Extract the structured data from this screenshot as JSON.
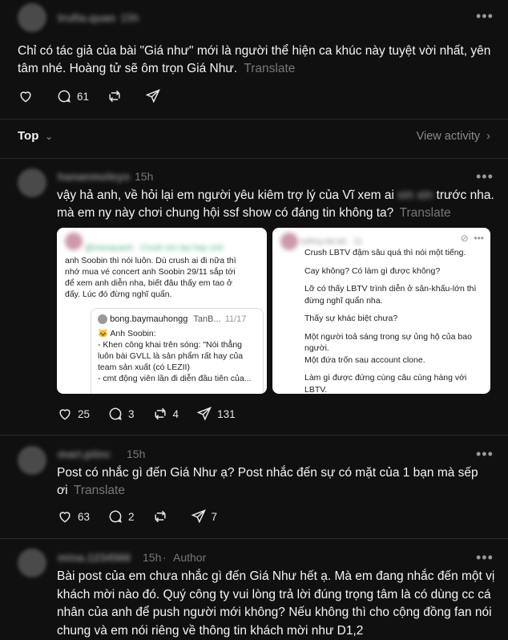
{
  "top_post": {
    "username": "trufia.quan",
    "time": "15h",
    "line1": "Chỉ có tác giả của bài \"Giá như\" mới là người thể hiện ca khúc này tuyệt vời nhất, yên",
    "line2": "tâm nhé. Hoàng tử sẽ ôm trọn Giá Như.",
    "translate": "Translate",
    "replies": "61"
  },
  "sort_bar": {
    "label": "Top",
    "view_activity": "View activity"
  },
  "reply1": {
    "username": "hananmoleyo",
    "time": "15h",
    "line1": "vậy hả anh, về hỏi lại em người yêu kiêm trợ lý của Vĩ xem ai",
    "blurred": "xin xin",
    "line1_end": "trước nha.",
    "line2": "mà em ny này chơi chung hội ssf show có đáng tin không ta?",
    "translate": "Translate",
    "likes": "25",
    "replies": "3",
    "reposts": "4",
    "shares": "131",
    "img1": {
      "l1": "anh Soobin thì nói luôn. Dù crush ai đi nữa thì",
      "l2": "nhớ mua vé concert anh Soobin 29/11 sắp tới",
      "l3": "để xem anh diễn nha, biết đâu thấy em tao ở",
      "l4": "đấy. Lúc đó đừng nghĩ quẩn.",
      "q_user": "bong.baymauhongg",
      "q_more": "TanB...",
      "q_date": "11/17",
      "q1": "Anh Soobin:",
      "q2": "- Khen công khai trên sóng: \"Nói thẳng",
      "q3": "luôn bài GVLL là sản phẩm rất hay của",
      "q4": "team sản xuất (có LEZII)",
      "q5": "- cmt động viên lần đi diễn đầu tiên của..."
    },
    "img2": {
      "l1": "Crush LBTV đậm sâu quá thì nói một tiếng.",
      "l2": "Cay không? Có làm gì được không?",
      "l3": "Lỡ có thấy LBTV trình diễn ở sân-khấu-lớn thì",
      "l4": "đừng nghĩ quẩn nha.",
      "l5": "Thấy sự khác biệt chưa?",
      "l6": "Một người toả sáng trong sự ủng hộ của bao",
      "l7": "người.",
      "l8": "Một đứa trốn sau account clone.",
      "l9": "Làm gì được đứng cùng câu cùng hàng với",
      "l10": "LBTV."
    }
  },
  "reply2": {
    "username": "mari.piinc",
    "time": "15h",
    "line1": "Post có nhắc gì đến Giá Như ạ? Post nhắc đến sự có mặt của 1 bạn mà sếp",
    "line2": "ơi",
    "translate": "Translate",
    "likes": "63",
    "replies": "2",
    "shares": "7"
  },
  "reply3": {
    "username": "mina.1234566",
    "time": "15h",
    "author_tag": "Author",
    "line1": "Bài post của em chưa nhắc gì đến Giá Như hết ạ. Mà em đang nhắc đến một vị",
    "line2": "khách mời nào đó. Quý công ty vui lòng trả lời đúng trọng tâm là có dùng cc cá",
    "line3": "nhân của anh để push người mới không? Nếu không thì cho cộng đồng fan nói",
    "line4": "chung và em nói riêng về thông tin khách mời như D1,2"
  },
  "colors": {
    "background": "#101010",
    "text": "#f3f5f7",
    "muted": "#777777"
  }
}
